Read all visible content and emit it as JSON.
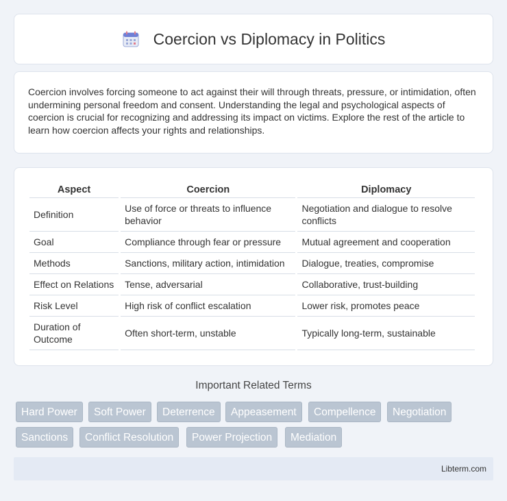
{
  "header": {
    "title": "Coercion vs Diplomacy in Politics",
    "icon": "calendar-icon"
  },
  "intro": {
    "text": "Coercion involves forcing someone to act against their will through threats, pressure, or intimidation, often undermining personal freedom and consent. Understanding the legal and psychological aspects of coercion is crucial for recognizing and addressing its impact on victims. Explore the rest of the article to learn how coercion affects your rights and relationships."
  },
  "table": {
    "headers": [
      "Aspect",
      "Coercion",
      "Diplomacy"
    ],
    "rows": [
      [
        "Definition",
        "Use of force or threats to influence behavior",
        "Negotiation and dialogue to resolve conflicts"
      ],
      [
        "Goal",
        "Compliance through fear or pressure",
        "Mutual agreement and cooperation"
      ],
      [
        "Methods",
        "Sanctions, military action, intimidation",
        "Dialogue, treaties, compromise"
      ],
      [
        "Effect on Relations",
        "Tense, adversarial",
        "Collaborative, trust-building"
      ],
      [
        "Risk Level",
        "High risk of conflict escalation",
        "Lower risk, promotes peace"
      ],
      [
        "Duration of Outcome",
        "Often short-term, unstable",
        "Typically long-term, sustainable"
      ]
    ]
  },
  "related": {
    "title": "Important Related Terms",
    "tags": [
      "Hard Power",
      "Soft Power",
      "Deterrence",
      "Appeasement",
      "Compellence",
      "Negotiation",
      "Sanctions",
      "Conflict Resolution",
      "Power Projection",
      "Mediation"
    ]
  },
  "footer": {
    "text": "Libterm.com"
  },
  "colors": {
    "background": "#f0f3f8",
    "tag_bg": "#bac5d2",
    "footer_bg": "#e4eaf4"
  }
}
